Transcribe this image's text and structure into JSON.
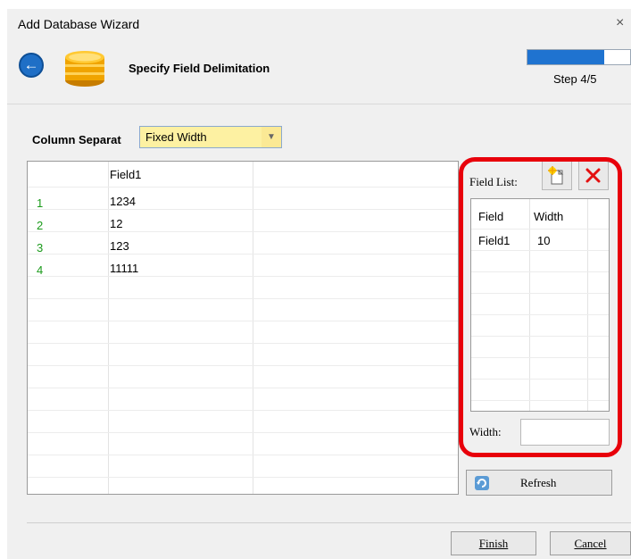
{
  "window": {
    "title": "Add Database Wizard"
  },
  "header": {
    "title": "Specify Field Delimitation",
    "step": "Step 4/5",
    "progress_fraction": 0.75
  },
  "separator": {
    "label": "Column Separat",
    "value": "Fixed Width"
  },
  "grid": {
    "column_header": "Field1",
    "rows": [
      {
        "num": "1",
        "value": "1234"
      },
      {
        "num": "2",
        "value": "12"
      },
      {
        "num": "3",
        "value": "123"
      },
      {
        "num": "4",
        "value": "11111"
      }
    ]
  },
  "field_list": {
    "label": "Field List:",
    "headers": {
      "field": "Field",
      "width": "Width"
    },
    "rows": [
      {
        "field": "Field1",
        "width": "10"
      }
    ],
    "width_label": "Width:",
    "width_value": ""
  },
  "buttons": {
    "refresh": "Refresh",
    "finish": "Finish",
    "cancel": "Cancel"
  },
  "icons": {
    "back": "back-arrow-icon",
    "database": "database-icon",
    "new_field": "new-field-icon",
    "delete_field": "delete-field-icon",
    "refresh": "refresh-icon"
  },
  "colors": {
    "accent": "#1f73d0",
    "highlight": "#e8000b",
    "row_number": "#1a9a1a",
    "combo_bg": "#fdf1a2"
  }
}
